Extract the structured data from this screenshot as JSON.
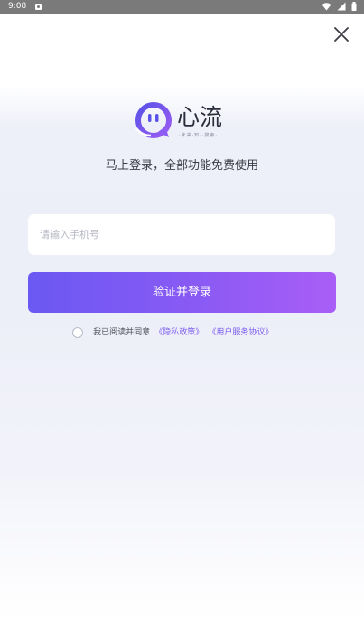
{
  "status_bar": {
    "time": "9:08"
  },
  "app": {
    "name": "心流",
    "subtitle": "·未来·知··搜索·"
  },
  "tagline": "马上登录，全部功能免费使用",
  "phone": {
    "placeholder": "请输入手机号",
    "value": ""
  },
  "login_button": "验证并登录",
  "agreement": {
    "checked": false,
    "prefix": "我已阅读并同意",
    "privacy_link": "《隐私政策》",
    "terms_link": "《用户服务协议》"
  },
  "colors": {
    "accent": "#7b5cf0",
    "button_gradient_start": "#6b58f2",
    "button_gradient_end": "#a95ef6",
    "status_bar": "#7a7a7a"
  },
  "icons": [
    "close-icon",
    "app-logo-icon",
    "wifi-icon",
    "signal-icon",
    "battery-icon",
    "notification-icon"
  ]
}
